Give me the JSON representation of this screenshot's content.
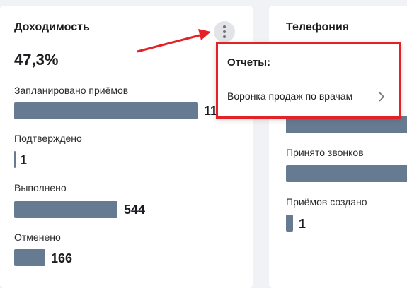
{
  "left_card": {
    "title": "Доходимость",
    "big_value": "47,3%",
    "metrics": [
      {
        "label": "Запланировано приёмов",
        "value": "11"
      },
      {
        "label": "Подтверждено",
        "value": "1"
      },
      {
        "label": "Выполнено",
        "value": "544"
      },
      {
        "label": "Отменено",
        "value": "166"
      }
    ]
  },
  "right_card": {
    "title": "Телефония",
    "metrics": [
      {
        "label": "Принято звонков",
        "value": ""
      },
      {
        "label": "Приёмов создано",
        "value": "1"
      }
    ]
  },
  "menu": {
    "title": "Отчеты:",
    "items": [
      {
        "label": "Воронка продаж по врачам"
      }
    ]
  },
  "icons": {
    "kebab": "more-vertical-icon",
    "chevron": "chevron-right-icon"
  },
  "colors": {
    "bar": "#667b92",
    "highlight": "#e32227",
    "arrow": "#e32227"
  }
}
